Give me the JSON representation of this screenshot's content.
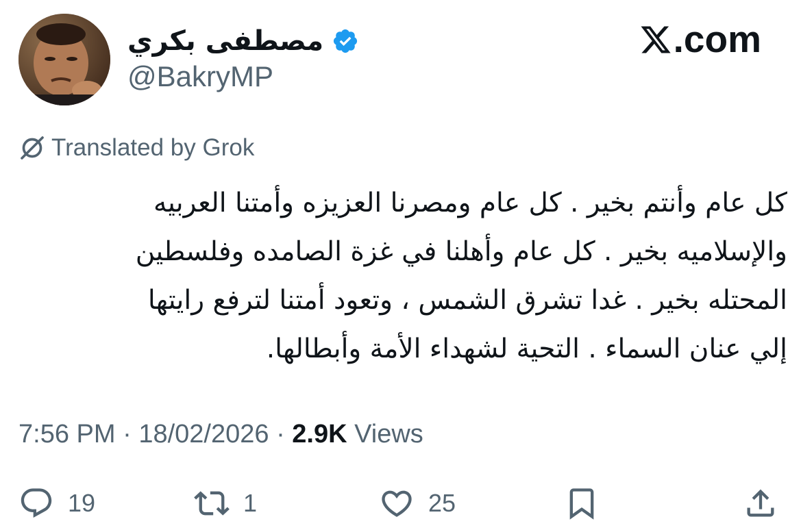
{
  "author": {
    "display_name": "مصطفى بكري",
    "handle": "@BakryMP",
    "verified": true,
    "verified_color": "#1d9bf0"
  },
  "site": {
    "logo_text": ".com",
    "logo_icon": "x-logo-icon"
  },
  "translation": {
    "label": "Translated by Grok",
    "icon": "grok-icon"
  },
  "tweet": {
    "text": "كل عام وأنتم بخير . كل عام ومصرنا العزيزه وأمتنا العربيه\nوالإسلاميه بخير . كل عام وأهلنا في غزة الصامده وفلسطين\nالمحتله بخير . غدا تشرق الشمس ، وتعود أمتنا لترفع رايتها\nإلي عنان السماء . التحية لشهداء الأمة وأبطالها."
  },
  "meta": {
    "time": "7:56 PM",
    "separator": "·",
    "date": "18/02/2026",
    "views_count": "2.9K",
    "views_label": "Views"
  },
  "actions": {
    "reply_count": "19",
    "repost_count": "1",
    "like_count": "25"
  },
  "colors": {
    "text_primary": "#0f1419",
    "text_secondary": "#536471",
    "background": "#ffffff"
  }
}
